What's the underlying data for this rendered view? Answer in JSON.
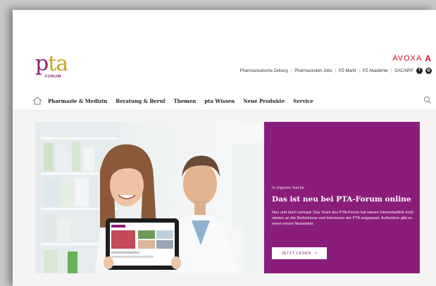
{
  "brand": {
    "logo_main": "pta",
    "logo_sub": "FORUM",
    "publisher": "AVOXA",
    "publisher_mark": "A"
  },
  "toplinks": [
    "Pharmazeutische Zeitung",
    "Pharmazeuten Jobs",
    "PZ Markt",
    "PZ Akademie",
    "DAC/NRF"
  ],
  "nav": {
    "items": [
      "Pharmazie & Medizin",
      "Beratung & Beruf",
      "Themen",
      "pta Wissen",
      "Neue Produkte",
      "Service"
    ]
  },
  "hero": {
    "kicker": "In eigener Sache",
    "headline": "Das ist neu bei PTA-Forum online",
    "teaser": "Neu und doch vertraut: Das Team des PTA-Forum hat seinen Internetauftritt noch stärker an die Bedürfnisse und Interessen der PTA angepasst. Außerdem gibt es einen neuen Newsletter.",
    "cta_label": "JETZT LESEN",
    "cta_arrow": ">"
  },
  "colors": {
    "brand_purple": "#8b1d7a",
    "brand_gold": "#c9a227",
    "avoxa_red": "#c8102e"
  },
  "icons": {
    "home": "home-icon",
    "search": "search-icon",
    "facebook": "facebook-icon",
    "instagram": "instagram-icon"
  }
}
